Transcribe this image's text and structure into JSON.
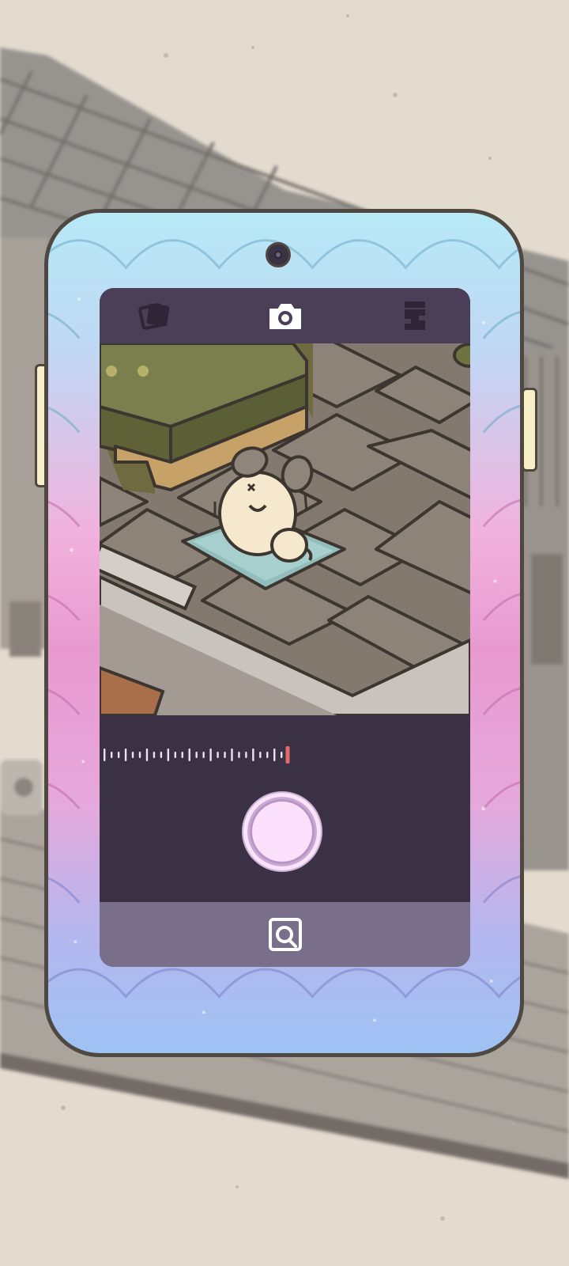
{
  "app": {
    "mode": "camera",
    "icons": {
      "left": "photo-album-icon",
      "center": "camera-icon",
      "right": "character-costume-icon",
      "bottom": "gallery-frame-icon"
    },
    "zoom": {
      "level_fraction": 1.0,
      "ticks": 26
    },
    "colors": {
      "top_bar": "#4b3f58",
      "control_area": "#3a3244",
      "bottom_bar": "#7a6f8a",
      "zoom_indicator": "#e46a6a",
      "shutter": "#fbe4fb"
    }
  }
}
